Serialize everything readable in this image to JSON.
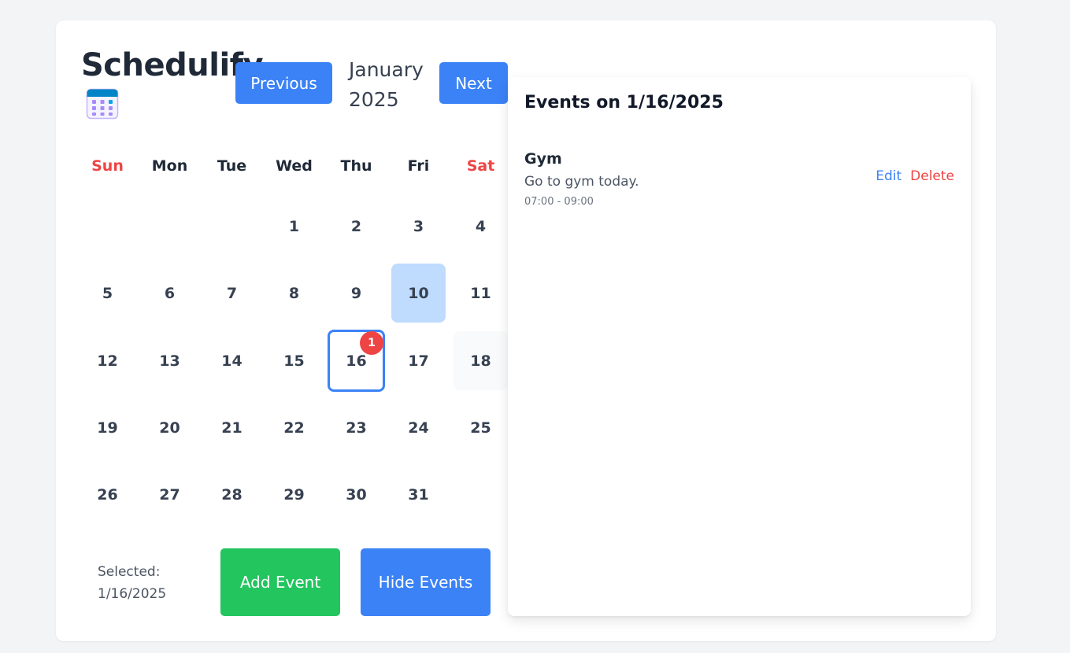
{
  "app": {
    "title": "Schedulify"
  },
  "nav": {
    "previous_label": "Previous",
    "next_label": "Next",
    "month": "January",
    "year": "2025"
  },
  "calendar": {
    "weekdays": [
      "Sun",
      "Mon",
      "Tue",
      "Wed",
      "Thu",
      "Fri",
      "Sat"
    ],
    "weeks": [
      [
        "",
        "",
        "",
        "1",
        "2",
        "3",
        "4"
      ],
      [
        "5",
        "6",
        "7",
        "8",
        "9",
        "10",
        "11"
      ],
      [
        "12",
        "13",
        "14",
        "15",
        "16",
        "17",
        "18"
      ],
      [
        "19",
        "20",
        "21",
        "22",
        "23",
        "24",
        "25"
      ],
      [
        "26",
        "27",
        "28",
        "29",
        "30",
        "31",
        ""
      ]
    ],
    "highlighted_day": "10",
    "selected_day": "16",
    "selected_day_event_count": "1",
    "weekend_color": "#ef4444",
    "accent_color": "#3b82f6"
  },
  "footer": {
    "selected_prefix": "Selected:",
    "selected_date": "1/16/2025",
    "add_event_label": "Add Event",
    "hide_events_label": "Hide Events"
  },
  "events_panel": {
    "title": "Events on 1/16/2025",
    "events": [
      {
        "title": "Gym",
        "description": "Go to gym today.",
        "time": "07:00 - 09:00",
        "edit_label": "Edit",
        "delete_label": "Delete"
      }
    ]
  }
}
